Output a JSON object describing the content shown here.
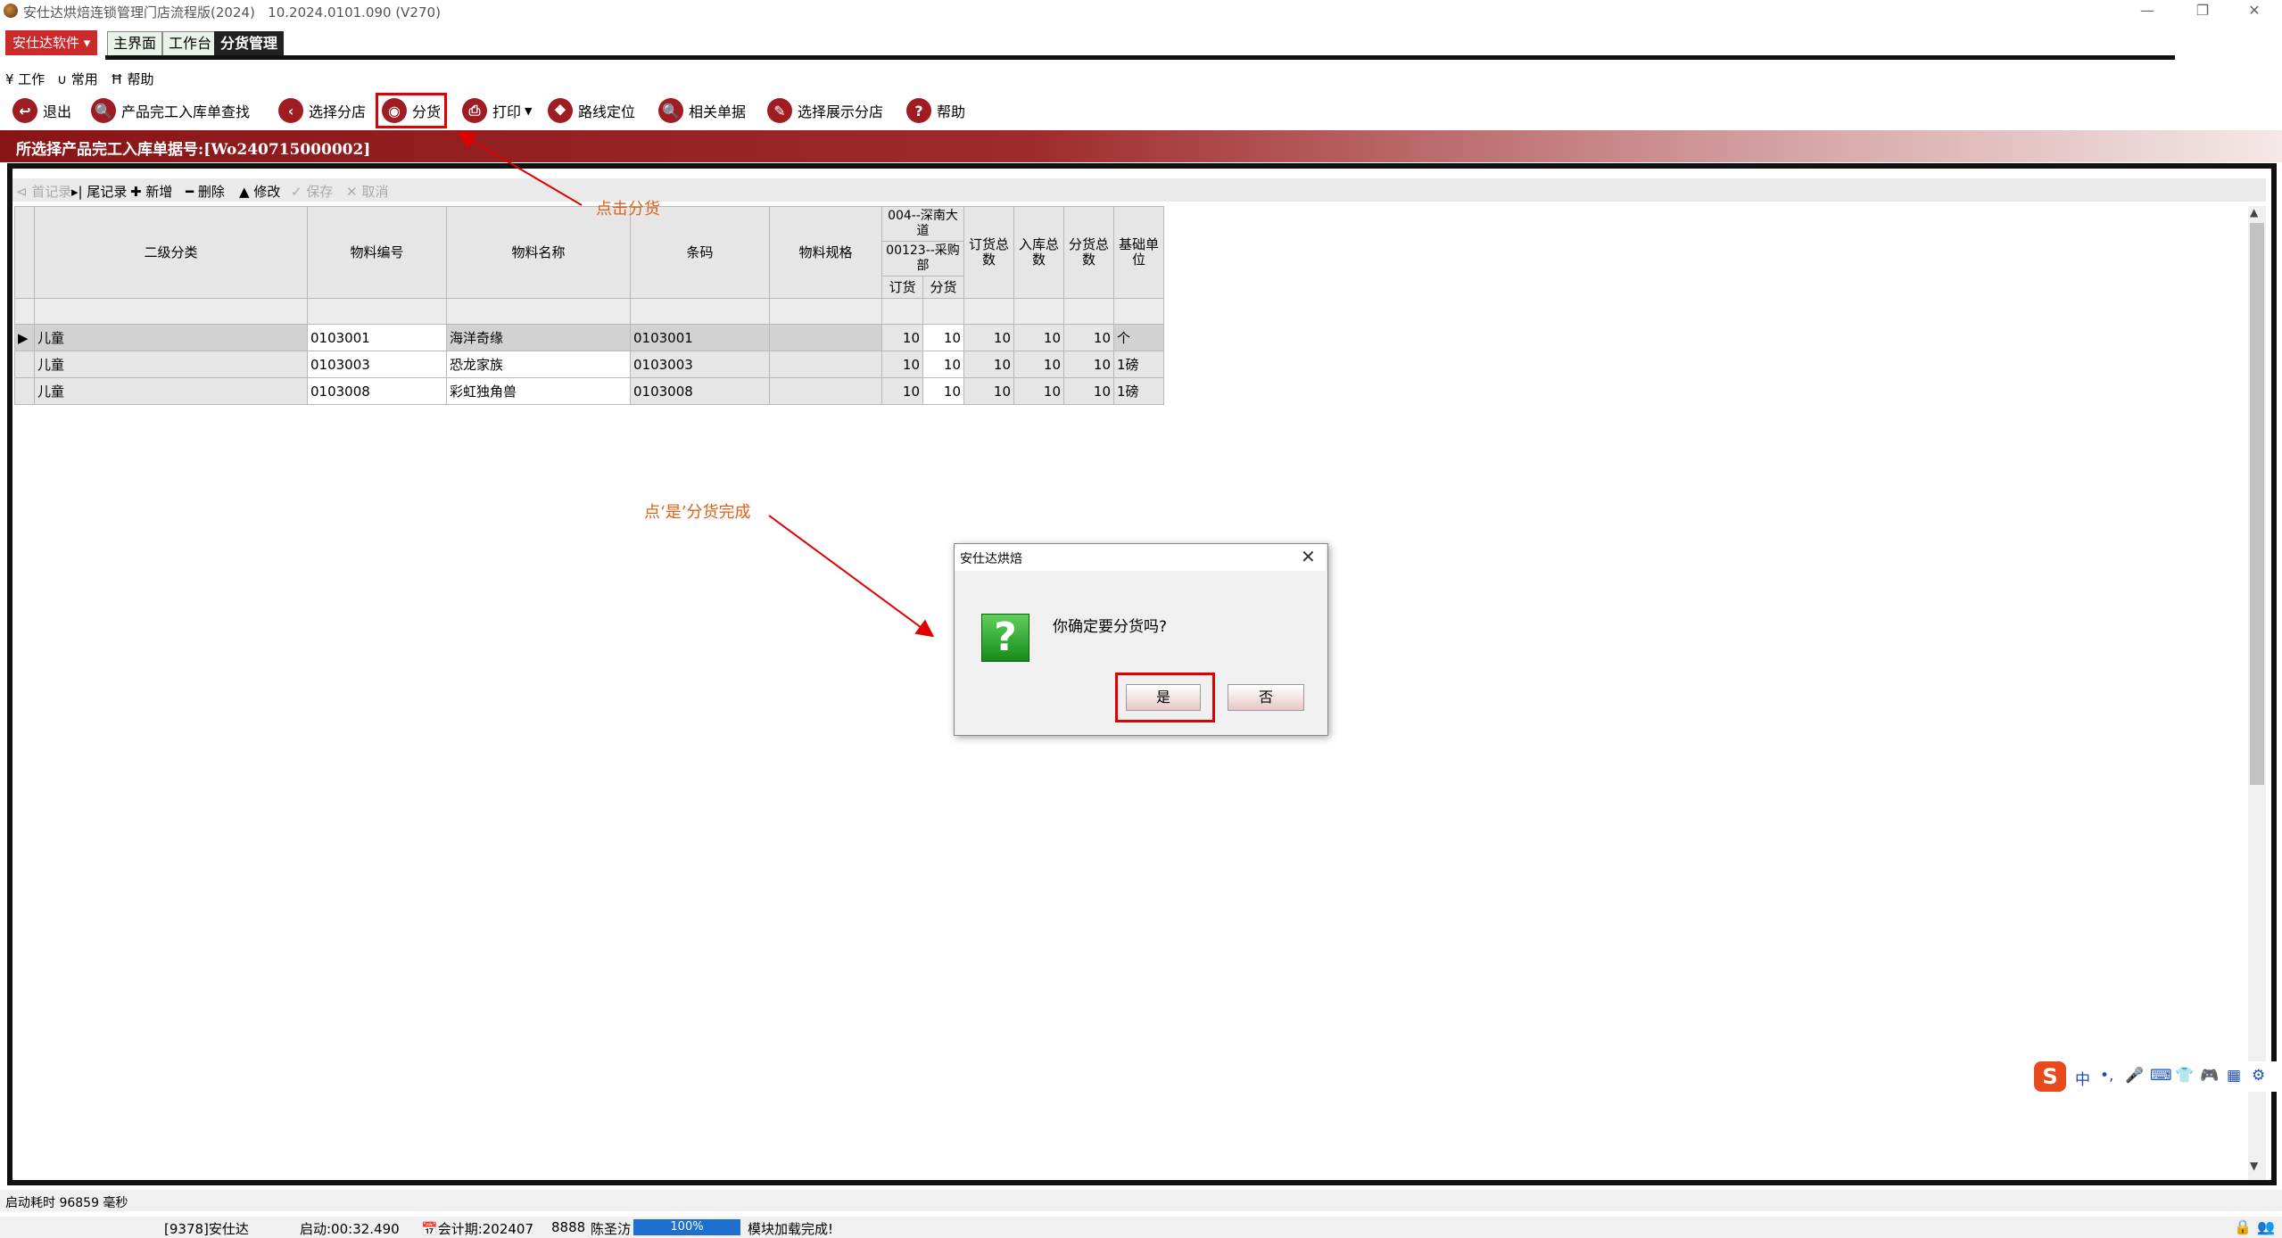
{
  "window": {
    "title": "安仕达烘焙连锁管理门店流程版(2024)   10.2024.0101.090 (V270)",
    "controls": [
      "—",
      "❐",
      "✕"
    ]
  },
  "tabs": {
    "brand": "安仕达软件",
    "items": [
      "主界面",
      "工作台",
      "分货管理"
    ]
  },
  "menu": [
    "¥ 工作",
    "∪ 常用",
    "Ħ 帮助"
  ],
  "toolbar": [
    {
      "label": "退出",
      "icon": "exit-icon"
    },
    {
      "label": "产品完工入库单查找",
      "icon": "search-icon"
    },
    {
      "label": "选择分店",
      "icon": "chevron-left-icon"
    },
    {
      "label": "分货",
      "icon": "distribute-icon"
    },
    {
      "label": "打印",
      "icon": "print-icon"
    },
    {
      "label": "路线定位",
      "icon": "route-icon"
    },
    {
      "label": "相关单据",
      "icon": "search-icon"
    },
    {
      "label": "选择展示分店",
      "icon": "edit-icon"
    },
    {
      "label": "帮助",
      "icon": "help-icon"
    }
  ],
  "header": {
    "text": "所选择产品完工入库单据号:[Wo240715000002]"
  },
  "nav": [
    "首记录",
    "尾记录",
    "新增",
    "删除",
    "修改",
    "保存",
    "取消"
  ],
  "grid": {
    "headers": {
      "category": "二级分类",
      "code": "物料编号",
      "name": "物料名称",
      "barcode": "条码",
      "spec": "物料规格",
      "store1": "004--深南大道",
      "store2": "00123--采购部",
      "sub_order": "订货",
      "sub_dist": "分货",
      "order_total": "订货总数",
      "in_total": "入库总数",
      "dist_total": "分货总数",
      "unit": "基础单位"
    },
    "rows": [
      {
        "category": "儿童",
        "code": "0103001",
        "name": "海洋奇缘",
        "barcode": "0103001",
        "spec": "",
        "order": "10",
        "dist": "10",
        "order_total": "10",
        "in_total": "10",
        "dist_total": "10",
        "unit": "个"
      },
      {
        "category": "儿童",
        "code": "0103003",
        "name": "恐龙家族",
        "barcode": "0103003",
        "spec": "",
        "order": "10",
        "dist": "10",
        "order_total": "10",
        "in_total": "10",
        "dist_total": "10",
        "unit": "1磅"
      },
      {
        "category": "儿童",
        "code": "0103008",
        "name": "彩虹独角兽",
        "barcode": "0103008",
        "spec": "",
        "order": "10",
        "dist": "10",
        "order_total": "10",
        "in_total": "10",
        "dist_total": "10",
        "unit": "1磅"
      }
    ]
  },
  "annotations": {
    "click_distribute": "点击分货",
    "click_yes": "点‘是’分货完成"
  },
  "dialog": {
    "title": "安仕达烘焙",
    "message": "你确定要分货吗?",
    "yes": "是",
    "no": "否"
  },
  "status1": {
    "load_time": "启动耗时 96859 毫秒"
  },
  "status2": {
    "user": "[9378]安仕达",
    "start": "启动:00:32.490",
    "period": "会计期:202407",
    "code": "8888",
    "name": "陈圣汸",
    "progress_label": "100%",
    "progress": 1.0,
    "message": "模块加载完成!"
  },
  "ime": {
    "items": [
      "中",
      "•,",
      "🎤",
      "⌨",
      "👕",
      "🎮",
      "▦",
      "⚙"
    ]
  },
  "colors": {
    "accent": "#9e1d22",
    "highlight": "#e00000",
    "annotation": "#e0601a"
  }
}
